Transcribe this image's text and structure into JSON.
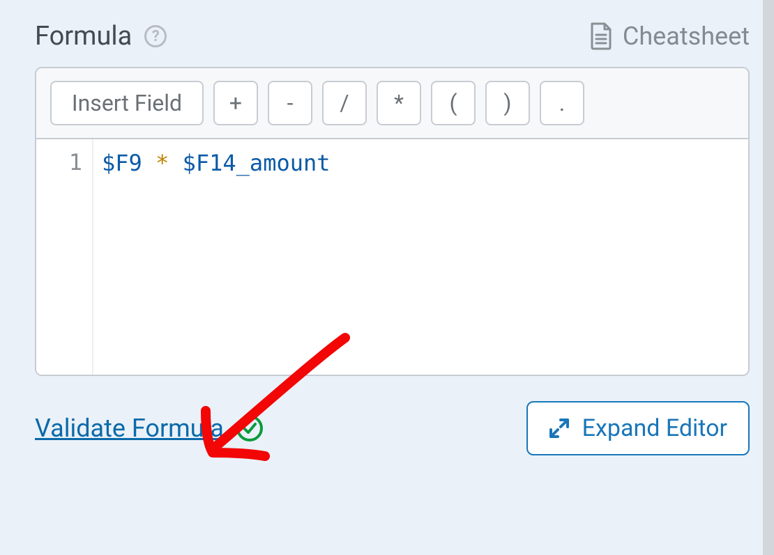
{
  "header": {
    "title": "Formula",
    "help_icon_label": "help",
    "cheatsheet_label": "Cheatsheet"
  },
  "toolbar": {
    "insert_field_label": "Insert Field",
    "op_add": "+",
    "op_sub": "-",
    "op_div": "/",
    "op_mul": "*",
    "op_lparen": "(",
    "op_rparen": ")",
    "op_dot": "."
  },
  "code": {
    "line_number": "1",
    "tokens": {
      "var1": "$F9",
      "op": "*",
      "var2": "$F14_amount"
    }
  },
  "footer": {
    "validate_label": "Validate Formula",
    "expand_label": "Expand Editor"
  }
}
